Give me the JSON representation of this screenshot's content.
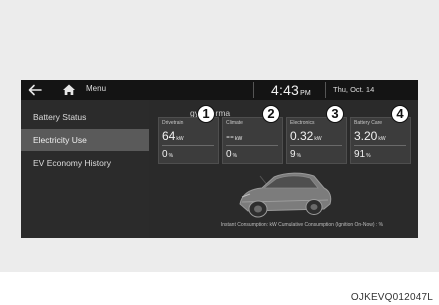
{
  "topbar": {
    "menu_label": "Menu",
    "time": "4:43",
    "ampm": "PM",
    "date": "Thu, Oct. 14"
  },
  "sidebar": {
    "items": [
      {
        "label": "Battery Status"
      },
      {
        "label": "Electricity Use"
      },
      {
        "label": "EV Economy History"
      }
    ],
    "selected": "Electricity Use"
  },
  "main": {
    "title": "gy Informa",
    "cards": [
      {
        "caption": "Drivetrain",
        "value": "64",
        "unit": "kW",
        "percent": "0",
        "percent_unit": "%",
        "marker": "1"
      },
      {
        "caption": "Climate",
        "value": "--",
        "unit": "kW",
        "percent": "0",
        "percent_unit": "%",
        "marker": "2"
      },
      {
        "caption": "Electronics",
        "value": "0.32",
        "unit": "kW",
        "percent": "9",
        "percent_unit": "%",
        "marker": "3"
      },
      {
        "caption": "Battery Care",
        "value": "3.20",
        "unit": "kW",
        "percent": "91",
        "percent_unit": "%",
        "marker": "4"
      }
    ],
    "legend": "Instant Consumption: kW    Cumulative Consumption (Ignition On-Now) : %"
  },
  "figure_code": "OJKEVQ012047L",
  "colors": {
    "screen_bg": "#2a2a2a",
    "topbar_bg": "#141414",
    "card_bg": "#3c3c3c",
    "active_item_bg": "#5a5a5a",
    "frame_bg": "#ececec"
  },
  "icons": {
    "back": "back-arrow-icon",
    "home": "home-icon"
  }
}
